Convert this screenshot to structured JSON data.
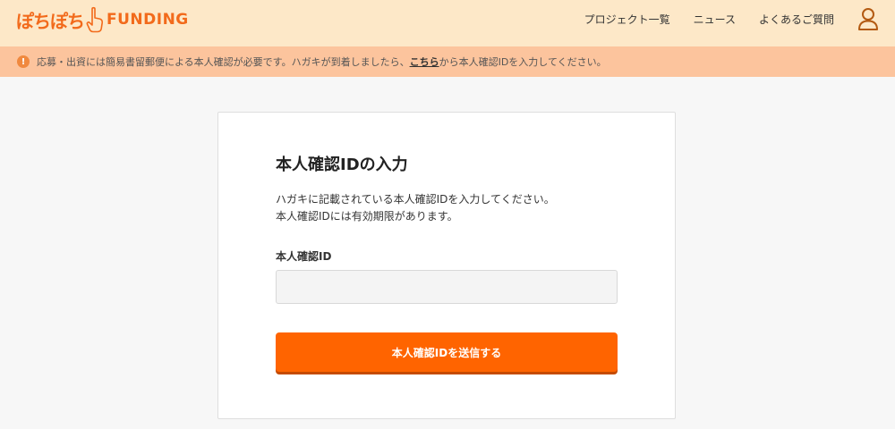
{
  "header": {
    "logo_jp": "ぽちぽち",
    "logo_en": "FUNDING",
    "nav": [
      {
        "label": "プロジェクト一覧"
      },
      {
        "label": "ニュース"
      },
      {
        "label": "よくあるご質問"
      }
    ],
    "user_icon": "user-icon"
  },
  "notice": {
    "icon": "info-icon",
    "text_before": "応募・出資には簡易書留郵便による本人確認が必要です。ハガキが到着しましたら、",
    "link_label": "こちら",
    "text_after": "から本人確認IDを入力してください。"
  },
  "form": {
    "title": "本人確認IDの入力",
    "description_line1": "ハガキに記載されている本人確認IDを入力してください。",
    "description_line2": "本人確認IDには有効期限があります。",
    "field_label": "本人確認ID",
    "field_value": "",
    "submit_label": "本人確認IDを送信する"
  },
  "colors": {
    "brand_orange": "#ff6400",
    "header_bg": "#fde8c8",
    "notice_bg": "#fcc49d"
  }
}
